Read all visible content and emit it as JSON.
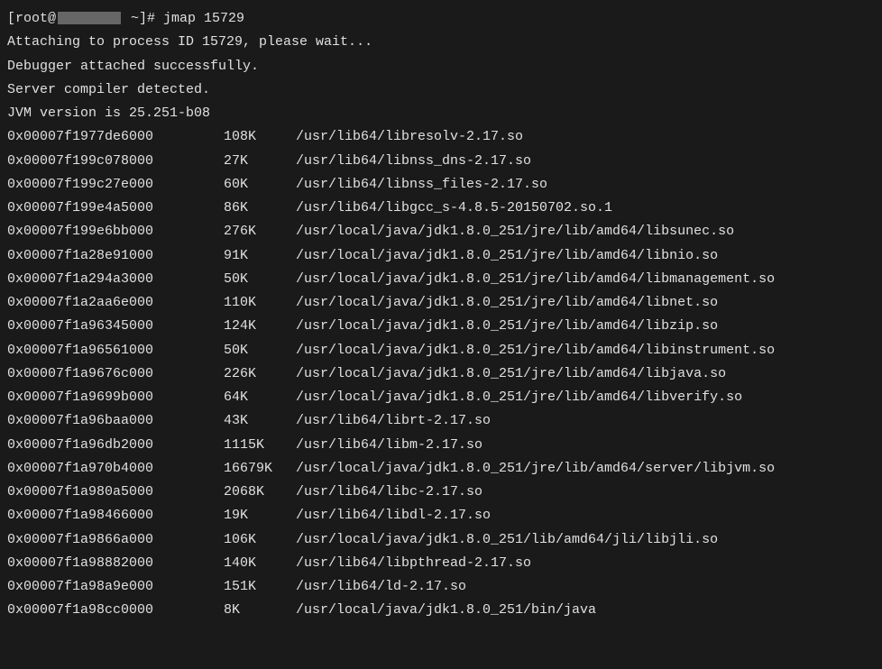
{
  "prompt": {
    "user": "[root@",
    "suffix": " ~]# ",
    "command": "jmap 15729"
  },
  "messages": [
    "Attaching to process ID 15729, please wait...",
    "Debugger attached successfully.",
    "Server compiler detected.",
    "JVM version is 25.251-b08"
  ],
  "mappings": [
    {
      "addr": "0x00007f1977de6000",
      "size": "108K",
      "path": "/usr/lib64/libresolv-2.17.so"
    },
    {
      "addr": "0x00007f199c078000",
      "size": "27K",
      "path": "/usr/lib64/libnss_dns-2.17.so"
    },
    {
      "addr": "0x00007f199c27e000",
      "size": "60K",
      "path": "/usr/lib64/libnss_files-2.17.so"
    },
    {
      "addr": "0x00007f199e4a5000",
      "size": "86K",
      "path": "/usr/lib64/libgcc_s-4.8.5-20150702.so.1"
    },
    {
      "addr": "0x00007f199e6bb000",
      "size": "276K",
      "path": "/usr/local/java/jdk1.8.0_251/jre/lib/amd64/libsunec.so"
    },
    {
      "addr": "0x00007f1a28e91000",
      "size": "91K",
      "path": "/usr/local/java/jdk1.8.0_251/jre/lib/amd64/libnio.so"
    },
    {
      "addr": "0x00007f1a294a3000",
      "size": "50K",
      "path": "/usr/local/java/jdk1.8.0_251/jre/lib/amd64/libmanagement.so"
    },
    {
      "addr": "0x00007f1a2aa6e000",
      "size": "110K",
      "path": "/usr/local/java/jdk1.8.0_251/jre/lib/amd64/libnet.so"
    },
    {
      "addr": "0x00007f1a96345000",
      "size": "124K",
      "path": "/usr/local/java/jdk1.8.0_251/jre/lib/amd64/libzip.so"
    },
    {
      "addr": "0x00007f1a96561000",
      "size": "50K",
      "path": "/usr/local/java/jdk1.8.0_251/jre/lib/amd64/libinstrument.so"
    },
    {
      "addr": "0x00007f1a9676c000",
      "size": "226K",
      "path": "/usr/local/java/jdk1.8.0_251/jre/lib/amd64/libjava.so"
    },
    {
      "addr": "0x00007f1a9699b000",
      "size": "64K",
      "path": "/usr/local/java/jdk1.8.0_251/jre/lib/amd64/libverify.so"
    },
    {
      "addr": "0x00007f1a96baa000",
      "size": "43K",
      "path": "/usr/lib64/librt-2.17.so"
    },
    {
      "addr": "0x00007f1a96db2000",
      "size": "1115K",
      "path": "/usr/lib64/libm-2.17.so"
    },
    {
      "addr": "0x00007f1a970b4000",
      "size": "16679K",
      "path": "/usr/local/java/jdk1.8.0_251/jre/lib/amd64/server/libjvm.so"
    },
    {
      "addr": "0x00007f1a980a5000",
      "size": "2068K",
      "path": "/usr/lib64/libc-2.17.so"
    },
    {
      "addr": "0x00007f1a98466000",
      "size": "19K",
      "path": "/usr/lib64/libdl-2.17.so"
    },
    {
      "addr": "0x00007f1a9866a000",
      "size": "106K",
      "path": "/usr/local/java/jdk1.8.0_251/lib/amd64/jli/libjli.so"
    },
    {
      "addr": "0x00007f1a98882000",
      "size": "140K",
      "path": "/usr/lib64/libpthread-2.17.so"
    },
    {
      "addr": "0x00007f1a98a9e000",
      "size": "151K",
      "path": "/usr/lib64/ld-2.17.so"
    },
    {
      "addr": "0x00007f1a98cc0000",
      "size": "8K",
      "path": "/usr/local/java/jdk1.8.0_251/bin/java"
    }
  ]
}
